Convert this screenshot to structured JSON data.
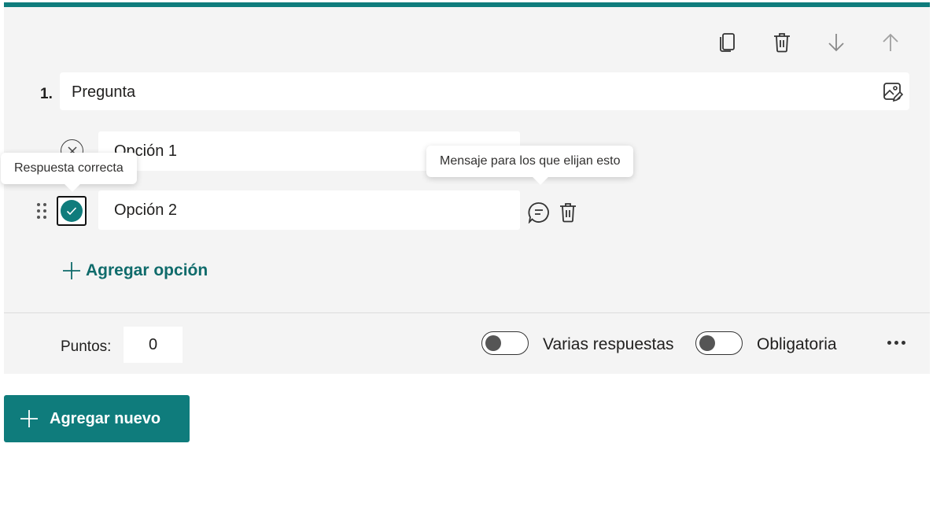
{
  "question": {
    "number": "1.",
    "title_value": "Pregunta"
  },
  "toolbar": {
    "copy_icon": "copy-icon",
    "delete_icon": "trash-icon",
    "move_down_icon": "arrow-down-icon",
    "move_up_icon": "arrow-up-icon"
  },
  "options": [
    {
      "label": "Opción 1",
      "correct": false
    },
    {
      "label": "Opción 2",
      "correct": true
    }
  ],
  "tooltips": {
    "correct_answer": "Respuesta correcta",
    "message": "Mensaje para los que elijan esto"
  },
  "add_option_label": "Agregar opción",
  "footer": {
    "points_label": "Puntos:",
    "points_value": "0",
    "multiple_answers_label": "Varias respuestas",
    "multiple_answers_on": false,
    "required_label": "Obligatoria",
    "required_on": false
  },
  "add_new_label": "Agregar nuevo",
  "colors": {
    "accent": "#0f7c7c",
    "card_bg": "#f4f4f4"
  }
}
